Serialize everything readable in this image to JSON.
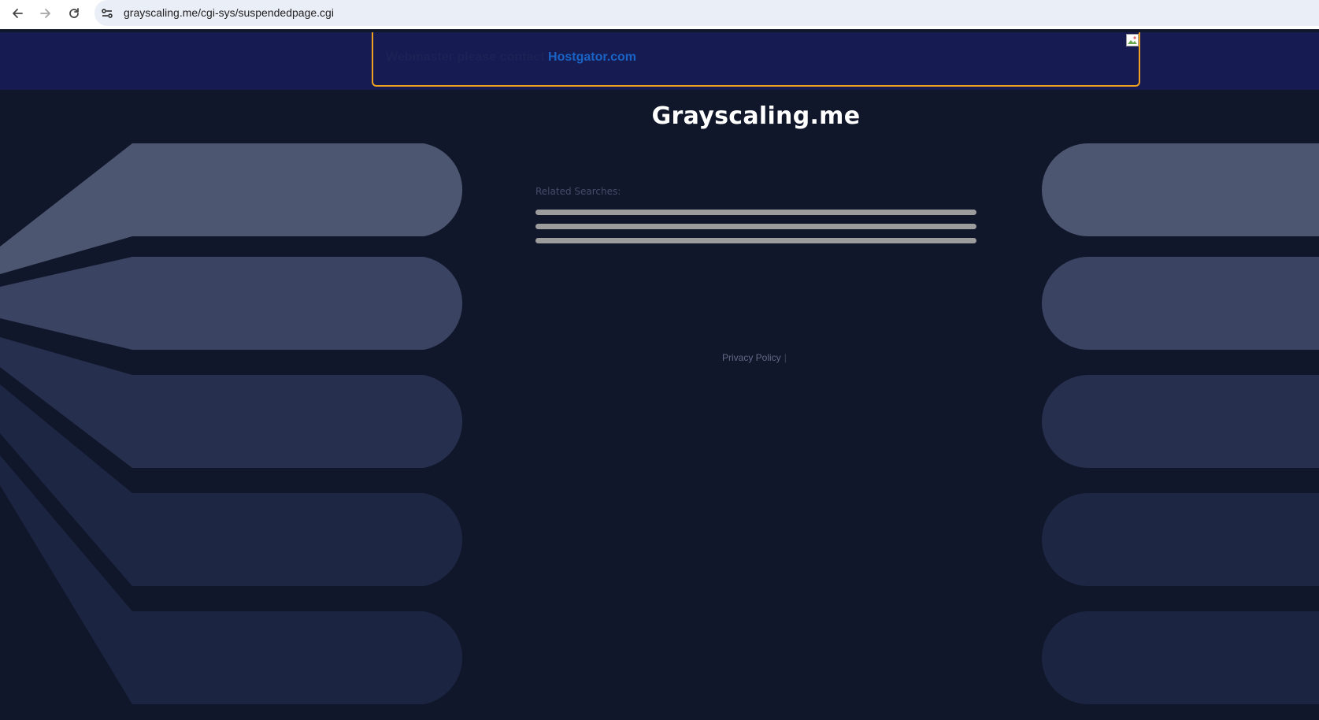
{
  "browser": {
    "url": "grayscaling.me/cgi-sys/suspendedpage.cgi"
  },
  "banner": {
    "prefix": "Webmaster please contact",
    "link": "Hostgator.com",
    "accent_color": "#f0a11f"
  },
  "page": {
    "title": "Grayscaling.me",
    "related_label": "Related Searches:",
    "privacy": "Privacy Policy",
    "privacy_separator": "|"
  },
  "colors": {
    "background": "#11172b",
    "banner_bg": "#161b52",
    "link": "#1a63c4"
  }
}
